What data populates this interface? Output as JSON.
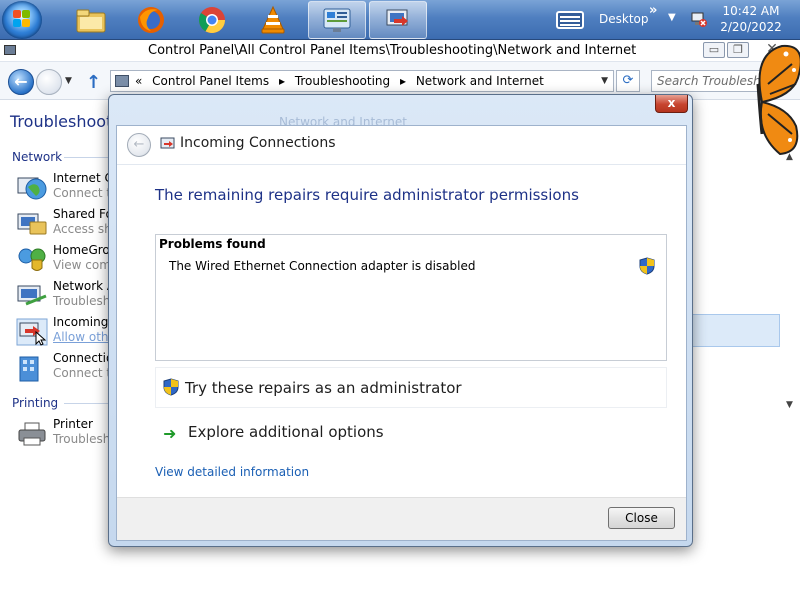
{
  "taskbar": {
    "desktop_label": "Desktop",
    "time": "10:42 AM",
    "date": "2/20/2022",
    "pinned": [
      {
        "name": "file-explorer-icon"
      },
      {
        "name": "firefox-icon"
      },
      {
        "name": "chrome-icon"
      },
      {
        "name": "vlc-icon"
      },
      {
        "name": "control-panel-icon"
      },
      {
        "name": "incoming-connections-icon"
      }
    ]
  },
  "window": {
    "title": "Control Panel\\All Control Panel Items\\Troubleshooting\\Network and Internet",
    "address": [
      "Control Panel Items",
      "Troubleshooting",
      "Network and Internet"
    ],
    "address_prefix": "«",
    "search_placeholder": "Search Troubleshooting"
  },
  "background": {
    "heading": "Troubleshoot problems - Network and Internet",
    "breadcrumb_behind": "Network and Internet",
    "groups": [
      {
        "label": "Network",
        "items": [
          {
            "title": "Internet Connections",
            "desc": "Connect to the Internet"
          },
          {
            "title": "Shared Folders",
            "desc": "Access shared files and folders"
          },
          {
            "title": "HomeGroup",
            "desc": "View computers or shared files in a homegroup"
          },
          {
            "title": "Network Adapter",
            "desc": "Troubleshoot network adapters"
          },
          {
            "title": "Incoming Connections",
            "desc": "Allow other computers to connect"
          },
          {
            "title": "Connection to a Workplace Using DirectAccess",
            "desc": "Connect to your workplace network"
          }
        ]
      },
      {
        "label": "Printing",
        "items": [
          {
            "title": "Printer",
            "desc": "Troubleshoot problems preventing printing"
          }
        ]
      }
    ]
  },
  "dialog": {
    "title": "Incoming Connections",
    "title_behind": "Network and Internet",
    "heading": "The remaining repairs require administrator permissions",
    "problems_header": "Problems found",
    "problem_item": "The Wired Ethernet Connection adapter is disabled",
    "admin_option": "Try these repairs as an administrator",
    "explore_option": "Explore additional options",
    "detail_link": "View detailed information",
    "close_label": "Close",
    "close_x": "x"
  }
}
